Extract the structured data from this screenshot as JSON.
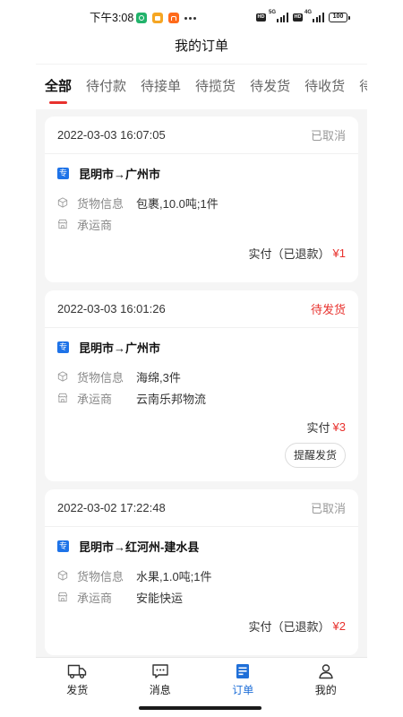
{
  "status_bar": {
    "time": "下午3:08",
    "notification_icons": [
      "app-notification-green-icon",
      "app-notification-orange-icon",
      "mi-app-icon",
      "more-notifications-icon"
    ],
    "sim1": {
      "hd": "HD",
      "network": "5G"
    },
    "sim2": {
      "hd": "HD",
      "network": "4G"
    },
    "battery": "100"
  },
  "header": {
    "title": "我的订单"
  },
  "tabs": {
    "items": [
      "全部",
      "待付款",
      "待接单",
      "待揽货",
      "待发货",
      "待收货",
      "待"
    ],
    "active_index": 0
  },
  "orders": [
    {
      "time": "2022-03-03 16:07:05",
      "status": "已取消",
      "status_color": "#999999",
      "badge": "专",
      "route": "昆明市→广州市",
      "cargo_label": "货物信息",
      "cargo": "包裹,10.0吨;1件",
      "carrier_label": "承运商",
      "paid_label": "实付（已退款）",
      "amount": "¥1"
    },
    {
      "time": "2022-03-03 16:01:26",
      "status": "待发货",
      "status_color": "#e8322e",
      "badge": "专",
      "route": "昆明市→广州市",
      "cargo_label": "货物信息",
      "cargo": "海绵,3件",
      "carrier_label": "承运商",
      "carrier": "云南乐邦物流",
      "paid_label": "实付",
      "amount": "¥3",
      "action_label": "提醒发货"
    },
    {
      "time": "2022-03-02 17:22:48",
      "status": "已取消",
      "status_color": "#999999",
      "badge": "专",
      "route": "昆明市→红河州-建水县",
      "cargo_label": "货物信息",
      "cargo": "水果,1.0吨;1件",
      "carrier_label": "承运商",
      "carrier": "安能快运",
      "paid_label": "实付（已退款）",
      "amount": "¥2"
    }
  ],
  "bottom_nav": {
    "items": [
      {
        "label": "发货",
        "icon": "truck-icon"
      },
      {
        "label": "消息",
        "icon": "message-icon"
      },
      {
        "label": "订单",
        "icon": "order-list-icon"
      },
      {
        "label": "我的",
        "icon": "profile-icon"
      }
    ],
    "active_index": 2
  },
  "colors": {
    "accent_red": "#e8322e",
    "active_blue": "#1f6fd8",
    "badge_blue": "#1e73e8",
    "muted_text": "#999999",
    "page_background": "#f5f5f5"
  }
}
